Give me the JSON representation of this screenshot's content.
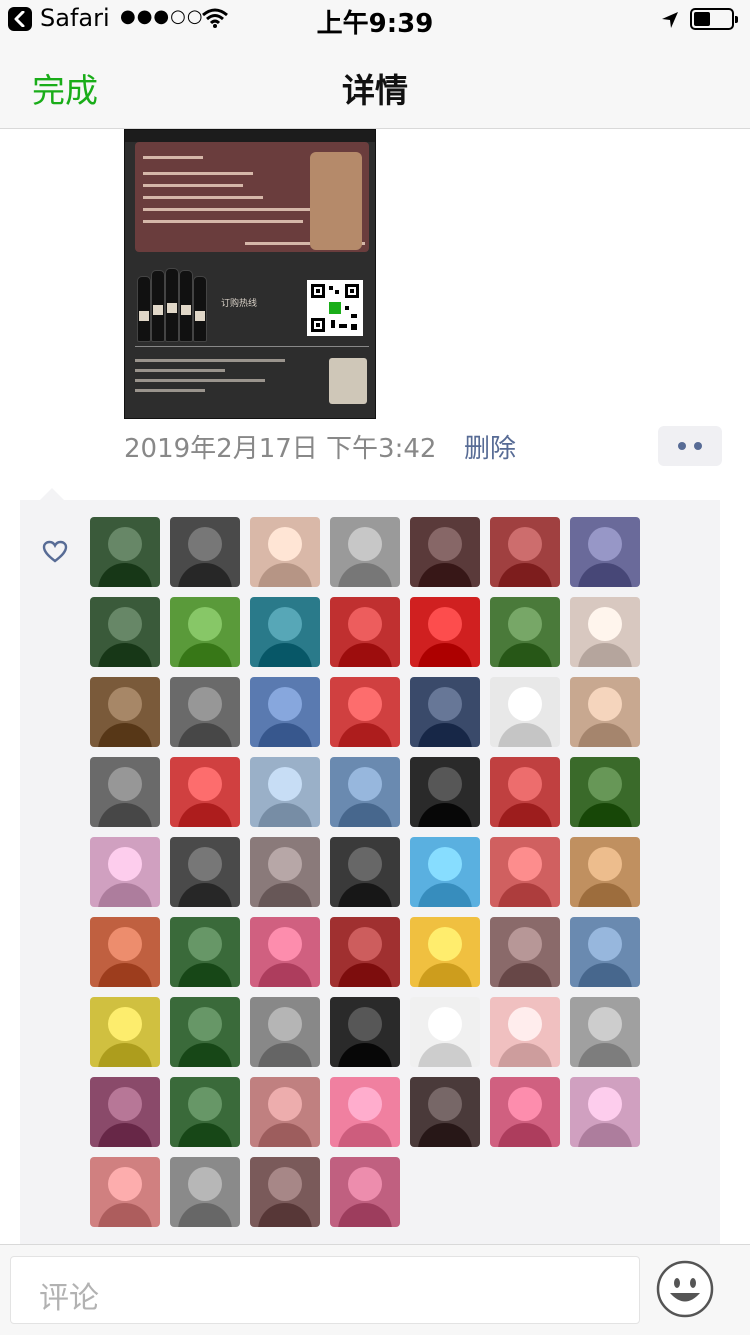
{
  "status_bar": {
    "app_name": "Safari",
    "signal": "●●●○○",
    "time": "上午9:39"
  },
  "nav": {
    "done_label": "完成",
    "title": "详情"
  },
  "poster": {
    "hotline": "订购热线"
  },
  "post": {
    "timestamp": "2019年2月17日 下午3:42",
    "delete_label": "删除"
  },
  "likes": {
    "avatars": [
      "#3a5a3a",
      "#4a4a4a",
      "#d9b8a8",
      "#9a9a9a",
      "#5a3a3a",
      "#a04040",
      "#6a6a9a",
      "#3a5a3a",
      "#5a9a3a",
      "#2a7a8a",
      "#c03030",
      "#d02020",
      "#4a7a3a",
      "#d8c8c0",
      "#7a5a3a",
      "#6a6a6a",
      "#5a7ab0",
      "#d04040",
      "#3a4a6a",
      "#e8e8e8",
      "#c8a890",
      "#6a6a6a",
      "#d04040",
      "#9ab0c8",
      "#6a8ab0",
      "#2a2a2a",
      "#c04040",
      "#3a6a2a",
      "#d0a0c0",
      "#4a4a4a",
      "#8a7a7a",
      "#3a3a3a",
      "#5ab0e0",
      "#d06060",
      "#c09060",
      "#c06040",
      "#3a6a3a",
      "#d06080",
      "#a03030",
      "#f0c040",
      "#8a6a6a",
      "#6a8ab0",
      "#d0c040",
      "#3a6a3a",
      "#888888",
      "#2a2a2a",
      "#f0f0f0",
      "#f0c0c0",
      "#a0a0a0",
      "#8a4a6a",
      "#3a6a3a",
      "#c08080",
      "#f080a0",
      "#4a3a3a",
      "#d06080",
      "#d0a0c0",
      "#d08080",
      "#8a8a8a",
      "#7a5a5a",
      "#c06080"
    ]
  },
  "comment": {
    "placeholder": "评论"
  }
}
